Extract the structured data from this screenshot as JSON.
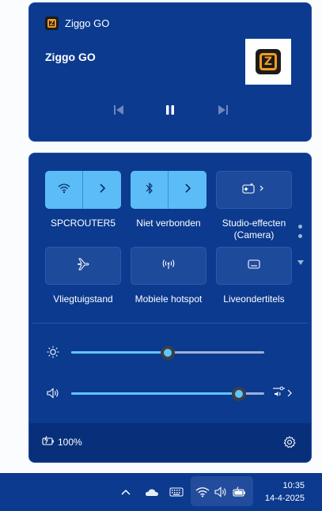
{
  "media": {
    "app_name": "Ziggo GO",
    "title": "Ziggo GO",
    "logo_letter": "Z",
    "controls": [
      "previous-icon",
      "pause-icon",
      "next-icon"
    ]
  },
  "tiles": [
    {
      "label": "SPCROUTER5",
      "icon": "wifi-icon",
      "active": true,
      "split": true
    },
    {
      "label": "Niet verbonden",
      "icon": "bluetooth-icon",
      "active": true,
      "split": true
    },
    {
      "label_line1": "Studio-effecten",
      "label_line2": "(Camera)",
      "icon": "studio-effects-icon",
      "active": false
    },
    {
      "label": "Vliegtuigstand",
      "icon": "airplane-icon",
      "active": false
    },
    {
      "label": "Mobiele hotspot",
      "icon": "hotspot-icon",
      "active": false
    },
    {
      "label": "Liveondertitels",
      "icon": "captions-icon",
      "active": false
    }
  ],
  "sliders": {
    "brightness": {
      "icon": "brightness-icon",
      "value": 0.5
    },
    "volume": {
      "icon": "volume-icon",
      "value": 0.87,
      "extra_icon": "audio-output-icon"
    }
  },
  "footer": {
    "battery_text": "100%",
    "battery_icon": "battery-charging-icon",
    "settings_icon": "gear-icon"
  },
  "taskbar": {
    "time": "10:35",
    "date": "14-4-2025",
    "icons": [
      "chevron-up-icon",
      "onedrive-icon",
      "keyboard-icon",
      "wifi-icon",
      "volume-icon",
      "battery-icon"
    ]
  },
  "colors": {
    "panel": "#0b3a8f",
    "accent": "#5bbcf7",
    "brand_orange": "#f39b1e"
  }
}
